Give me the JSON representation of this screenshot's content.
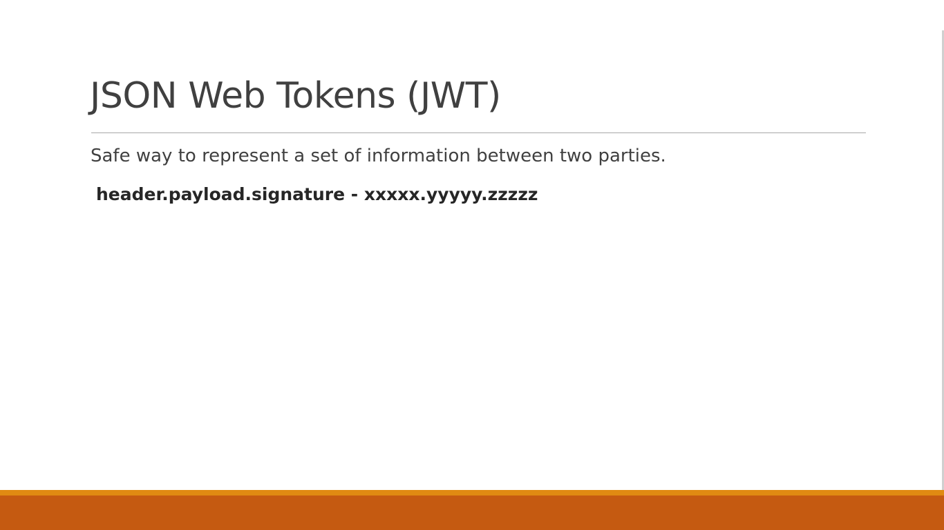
{
  "slide": {
    "title": "JSON Web Tokens (JWT)",
    "bullets": [
      "Safe way to represent a set of information between two parties.",
      "header.payload.signature - xxxxx.yyyyy.zzzzz"
    ]
  },
  "colors": {
    "title_text": "#404040",
    "body_text": "#404040",
    "strong_text": "#262626",
    "rule": "#a6a6a6",
    "footer_highlight": "#e08a12",
    "footer": "#c55a11"
  }
}
